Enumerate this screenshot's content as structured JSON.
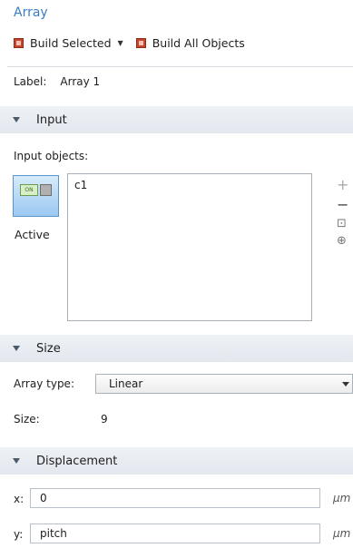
{
  "title": "Array",
  "toolbar": {
    "build_selected_label": "Build Selected",
    "build_selected_arrow": "▼",
    "build_all_label": "Build All Objects"
  },
  "label_field": {
    "label": "Label:",
    "value": "Array 1"
  },
  "input_section": {
    "title": "Input",
    "objects_label": "Input objects:",
    "active_icon_text": "ON",
    "active_label": "Active",
    "objects": [
      "c1"
    ]
  },
  "side_icons": [
    "+",
    "−",
    "⊡",
    "⊕"
  ],
  "size_section": {
    "title": "Size",
    "array_type_label": "Array type:",
    "array_type_value": "Linear",
    "size_label": "Size:",
    "size_value": "9"
  },
  "displacement_section": {
    "title": "Displacement",
    "x_label": "x:",
    "x_value": "0",
    "x_unit": "µm",
    "y_label": "y:",
    "y_value": "pitch",
    "y_unit": "µm"
  },
  "colors": {
    "title": "#3b7dc4",
    "section_bg": "#e6ebf1",
    "active_bg": "#b3d6f5"
  }
}
